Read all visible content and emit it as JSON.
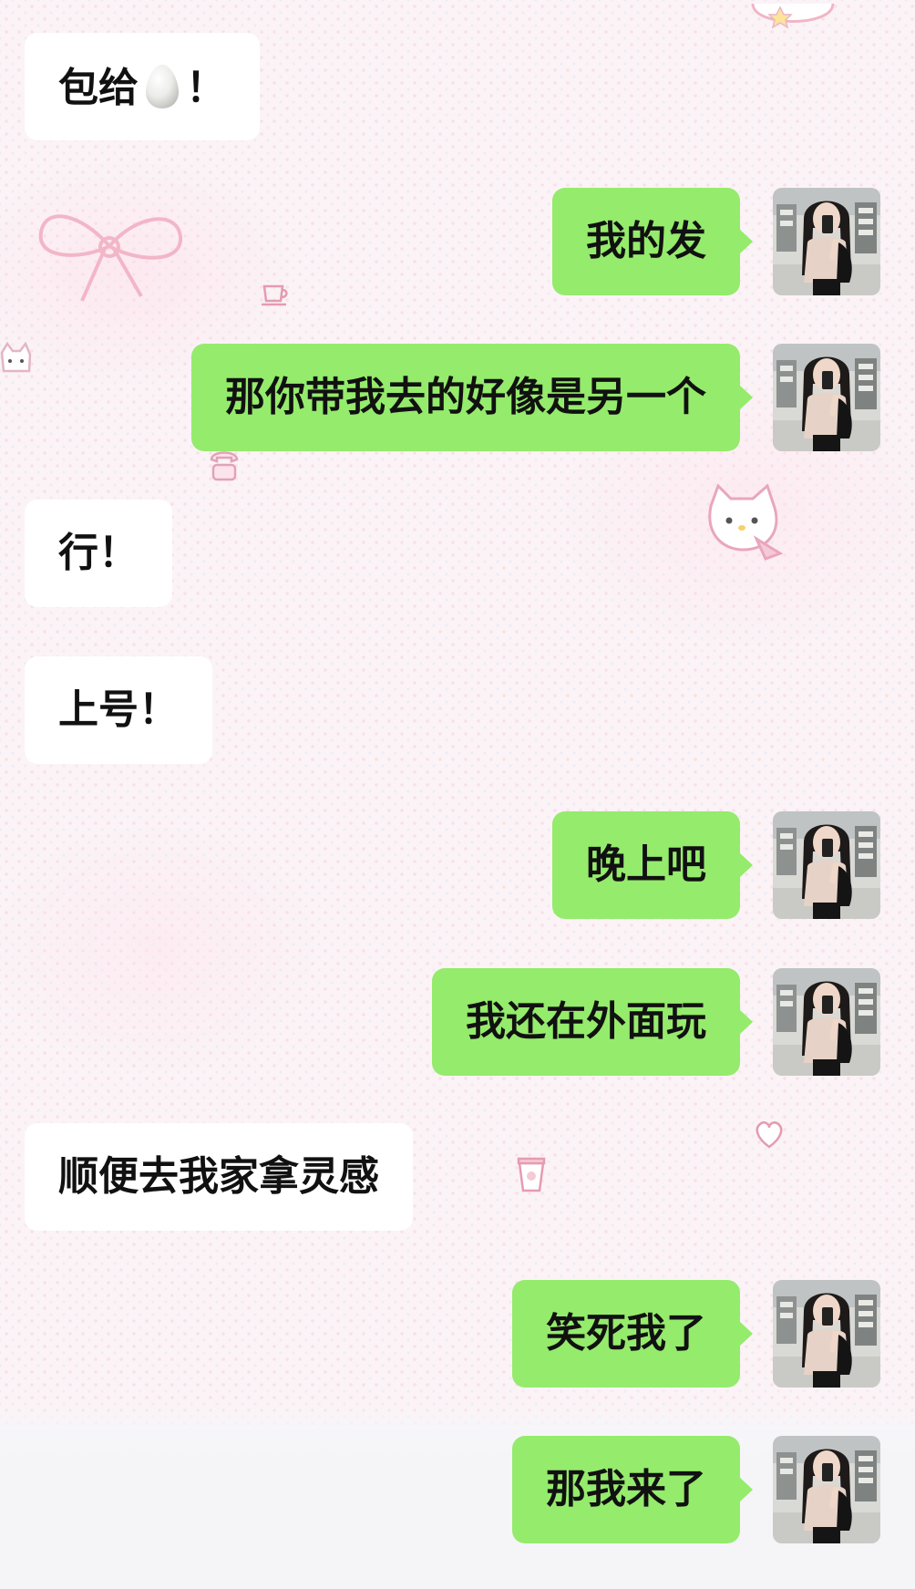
{
  "chat": {
    "messages": [
      {
        "side": "left",
        "text": "包给",
        "emoji": "egg",
        "suffix": "！"
      },
      {
        "side": "right",
        "text": "我的发"
      },
      {
        "side": "right",
        "text": "那你带我去的好像是另一个"
      },
      {
        "side": "left",
        "text": "行！"
      },
      {
        "side": "left",
        "text": "上号！"
      },
      {
        "side": "right",
        "text": "晚上吧"
      },
      {
        "side": "right",
        "text": "我还在外面玩"
      },
      {
        "side": "left",
        "text": "顺便去我家拿灵感"
      },
      {
        "side": "right",
        "text": "笑死我了"
      },
      {
        "side": "right",
        "text": "那我来了"
      }
    ]
  },
  "colors": {
    "outgoing_bubble": "#95eb6c",
    "incoming_bubble": "#ffffff",
    "text": "#111111",
    "background": "#fbf3f6"
  },
  "icons": {
    "avatar": "user-avatar-photo",
    "emoji": "egg-emoji"
  }
}
